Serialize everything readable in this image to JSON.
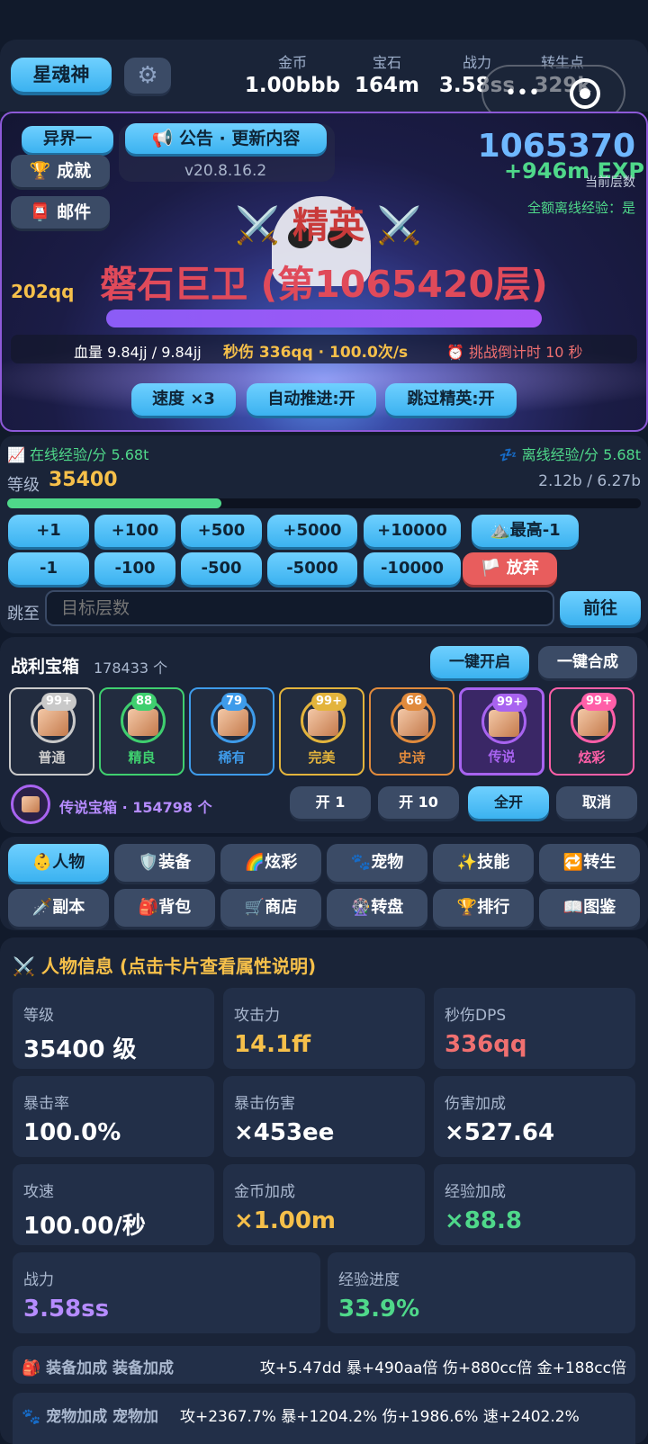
{
  "header": {
    "title_button": "星魂神",
    "stats": [
      {
        "label": "金币",
        "value": "1.00bbb"
      },
      {
        "label": "宝石",
        "value": "164m"
      },
      {
        "label": "战力",
        "value": "3.58ss"
      },
      {
        "label": "转生点",
        "value": "329k"
      }
    ]
  },
  "banner": {
    "world_button": "异界一",
    "announce_button": "📢 公告 · 更新内容",
    "version": "v20.8.16.2",
    "achieve_button": "🏆 成就",
    "mail_button": "📮 邮件",
    "floor_number": "1065370",
    "exp_gain": "+946m EXP",
    "current_floor_label": "当前层数",
    "offline_exp": "全额离线经验：是",
    "left_value": "202qq",
    "elite_title": "⚔️ 精英 ⚔️",
    "boss_name": "磐石巨卫 (第1065420层)",
    "hp_label": "血量",
    "hp_value": "9.84jj / 9.84jj",
    "dps_label": "秒伤 336qq",
    "rate": "100.0次/s",
    "countdown": "⏰ 挑战倒计时 10 秒",
    "speed_button": "速度 ×3",
    "auto_button": "自动推进:开",
    "skip_button": "跳过精英:开",
    "hp_fill": 1.0
  },
  "level": {
    "online_exp": "📈 在线经验/分 5.68t",
    "offline_exp": "💤 离线经验/分 5.68t",
    "label": "等级",
    "value": "35400",
    "progress_text": "2.12b / 6.27b",
    "progress": 0.338
  },
  "jump": {
    "plus": [
      "+1",
      "+100",
      "+500",
      "+5000",
      "+10000"
    ],
    "top_button": "⛰️最高-1",
    "minus": [
      "-1",
      "-100",
      "-500",
      "-5000",
      "-10000"
    ],
    "quit_button": "🏳️ 放弃",
    "label": "跳至",
    "placeholder": "目标层数",
    "go_button": "前往"
  },
  "chests": {
    "title": "战利宝箱",
    "count": "178433 个",
    "open_all_button": "一键开启",
    "merge_button": "一键合成",
    "items": [
      {
        "name": "普通",
        "badge": "99+",
        "color": "#c9c9c9"
      },
      {
        "name": "精良",
        "badge": "88",
        "color": "#3fcf6f"
      },
      {
        "name": "稀有",
        "badge": "79",
        "color": "#3e9bea"
      },
      {
        "name": "完美",
        "badge": "99+",
        "color": "#e3b43c"
      },
      {
        "name": "史诗",
        "badge": "66",
        "color": "#e08a3c"
      },
      {
        "name": "传说",
        "badge": "99+",
        "color": "#a863f0"
      },
      {
        "name": "炫彩",
        "badge": "99+",
        "color": "#ff5fa8"
      }
    ],
    "selected": "传说宝箱 · 154798 个",
    "open1": "开 1",
    "open10": "开 10",
    "openall": "全开",
    "cancel": "取消"
  },
  "tabs": [
    "👶人物",
    "🛡️装备",
    "🌈炫彩",
    "🐾宠物",
    "✨技能",
    "🔁转生",
    "🗡️副本",
    "🎒背包",
    "🛒商店",
    "🎡转盘",
    "🏆排行",
    "📖图鉴"
  ],
  "info": {
    "title": "⚔️ 人物信息 (点击卡片查看属性说明)",
    "cards": [
      {
        "label": "等级",
        "value": "35400 级",
        "color": "#ffffff"
      },
      {
        "label": "攻击力",
        "value": "14.1ff",
        "color": "#f6c04a"
      },
      {
        "label": "秒伤DPS",
        "value": "336qq",
        "color": "#f07070"
      },
      {
        "label": "暴击率",
        "value": "100.0%",
        "color": "#ffffff"
      },
      {
        "label": "暴击伤害",
        "value": "×453ee",
        "color": "#ffffff"
      },
      {
        "label": "伤害加成",
        "value": "×527.64",
        "color": "#ffffff"
      },
      {
        "label": "攻速",
        "value": "100.00/秒",
        "color": "#ffffff"
      },
      {
        "label": "金币加成",
        "value": "×1.00m",
        "color": "#f6c04a"
      },
      {
        "label": "经验加成",
        "value": "×88.8",
        "color": "#4fd88a"
      },
      {
        "label": "战力",
        "value": "3.58ss",
        "color": "#b68cff"
      },
      {
        "label": "经验进度",
        "value": "33.9%",
        "color": "#4fd88a"
      }
    ],
    "equip_label": "🎒 装备加成 装备加成",
    "equip_value": "攻+5.47dd 暴+490aa倍 伤+880cc倍 金+188cc倍",
    "pet_label": "🐾 宠物加成 宠物加",
    "pet_value": "攻+2367.7% 暴+1204.2% 伤+1986.6% 速+2402.2%"
  }
}
